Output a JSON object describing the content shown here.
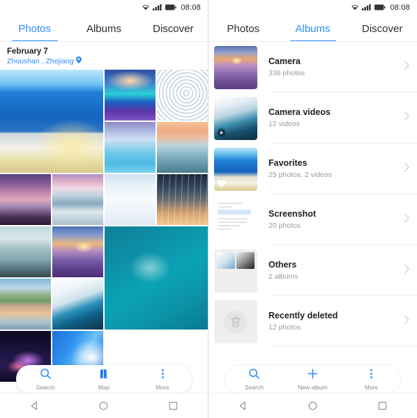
{
  "status_bar": {
    "time": "08:08",
    "wifi_icon": "wifi-icon",
    "signal_icon": "signal-icon",
    "battery_icon": "battery-icon"
  },
  "accent_color": "#2e8dfa",
  "left_screen": {
    "tabs": [
      {
        "label": "Photos",
        "active": true
      },
      {
        "label": "Albums",
        "active": false
      },
      {
        "label": "Discover",
        "active": false
      }
    ],
    "section": {
      "date": "February 7",
      "location": "Zhoushan , Zhejiang",
      "location_icon": "location-pin-icon"
    },
    "photos": [
      {
        "name": "santorini-blue-sea",
        "style": "p-santorini",
        "span": "big"
      },
      {
        "name": "aurora-reflection",
        "style": "p-aurora",
        "span": "one"
      },
      {
        "name": "water-ripples",
        "style": "p-ripple",
        "span": "one"
      },
      {
        "name": "tropical-lagoon",
        "style": "p-lagoon",
        "span": "one"
      },
      {
        "name": "sunset-pier-hut",
        "style": "p-pier",
        "span": "one"
      },
      {
        "name": "purple-boardwalk",
        "style": "p-boardwalk",
        "span": "one"
      },
      {
        "name": "coastal-cliffs",
        "style": "p-cliffs",
        "span": "one"
      },
      {
        "name": "snow-field",
        "style": "p-snow",
        "span": "one"
      },
      {
        "name": "glass-facade-sunset",
        "style": "p-glass",
        "span": "one"
      },
      {
        "name": "misty-lake-tree",
        "style": "p-mistlake",
        "span": "one"
      },
      {
        "name": "lavender-field-sunset",
        "style": "p-lavender",
        "span": "one"
      },
      {
        "name": "turquoise-boat-aerial",
        "style": "p-boat",
        "span": "big"
      },
      {
        "name": "mountain-lake-reflection",
        "style": "p-mountlake",
        "span": "one"
      },
      {
        "name": "iceberg-wave",
        "style": "p-iceberg",
        "span": "one"
      },
      {
        "name": "neon-abstract",
        "style": "p-neon",
        "span": "one"
      },
      {
        "name": "blue-wave-abstract",
        "style": "p-bluewave",
        "span": "one"
      }
    ],
    "action_bar": [
      {
        "label": "Search",
        "icon": "search-icon"
      },
      {
        "label": "Map",
        "icon": "map-icon"
      },
      {
        "label": "More",
        "icon": "more-dots-icon"
      }
    ]
  },
  "right_screen": {
    "tabs": [
      {
        "label": "Photos",
        "active": false
      },
      {
        "label": "Albums",
        "active": true
      },
      {
        "label": "Discover",
        "active": false
      }
    ],
    "albums": [
      {
        "name": "Camera",
        "count": "336 photos",
        "thumb_style": "p-camera-lav",
        "badge": "none"
      },
      {
        "name": "Camera videos",
        "count": "12 videos",
        "thumb_style": "p-camvid",
        "badge": "play"
      },
      {
        "name": "Favorites",
        "count": "25 photos, 2 videos",
        "thumb_style": "p-fav",
        "badge": "heart"
      },
      {
        "name": "Screenshot",
        "count": "20 photos",
        "thumb_style": "p-shot",
        "badge": "none"
      },
      {
        "name": "Others",
        "count": "2 albums",
        "thumb_style": "p-others",
        "badge": "none"
      },
      {
        "name": "Recently deleted",
        "count": "12 photos",
        "thumb_style": "p-deleted",
        "badge": "trash"
      }
    ],
    "action_bar": [
      {
        "label": "Search",
        "icon": "search-icon"
      },
      {
        "label": "New album",
        "icon": "plus-icon"
      },
      {
        "label": "More",
        "icon": "more-dots-icon"
      }
    ]
  },
  "nav_bar": [
    {
      "name": "back-button",
      "icon": "triangle-back-icon"
    },
    {
      "name": "home-button",
      "icon": "circle-home-icon"
    },
    {
      "name": "recents-button",
      "icon": "square-recents-icon"
    }
  ]
}
